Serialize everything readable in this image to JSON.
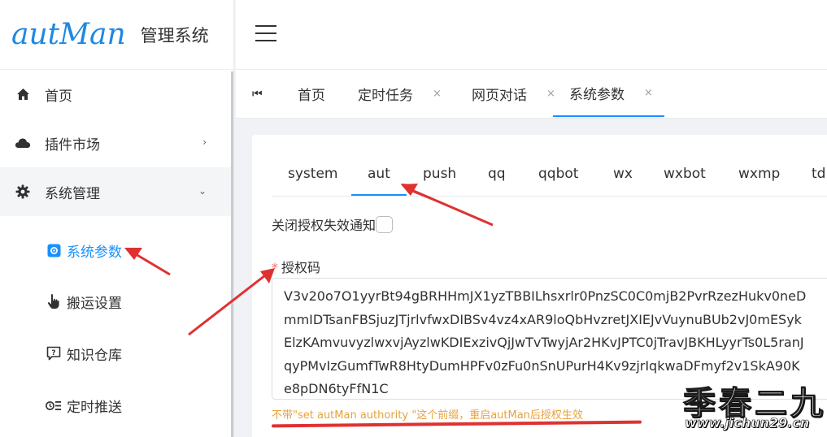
{
  "logo": {
    "brand": "autMan",
    "subtitle": "管理系统"
  },
  "sidebar": {
    "items": [
      {
        "label": "首页",
        "icon": "home-icon"
      },
      {
        "label": "插件市场",
        "icon": "cloud-icon"
      },
      {
        "label": "系统管理",
        "icon": "gear-icon"
      }
    ],
    "sub_items": [
      {
        "label": "系统参数",
        "icon": "settings-square-icon"
      },
      {
        "label": "搬运设置",
        "icon": "hand-pointer-icon"
      },
      {
        "label": "知识仓库",
        "icon": "question-chat-icon"
      },
      {
        "label": "定时推送",
        "icon": "timer-list-icon"
      }
    ]
  },
  "tabs": [
    {
      "label": "首页"
    },
    {
      "label": "定时任务",
      "close": "×"
    },
    {
      "label": "网页对话",
      "close": "×"
    },
    {
      "label": "系统参数",
      "close": "×"
    }
  ],
  "inner_tabs": [
    "system",
    "aut",
    "push",
    "qq",
    "qqbot",
    "wx",
    "wxbot",
    "wxmp",
    "td"
  ],
  "settings": {
    "notify_label": "关闭授权失效通知",
    "required_mark": "*",
    "auth_label": "授权码",
    "auth_lines": [
      "V3v20o7O1yyrBt94gBRHHmJX1yzTBBILhsxrlr0PnzSC0C0mjB2PvrRzezHukv0neD",
      "mmIDTsanFBSjuzJTjrlvfwxDIBSv4vz4xAR9loQbHvzretJXIEJvVuynuBUb2vJ0mESyk",
      "ElzKAmvuvyzlwxvjAyzlwKDIExzivQjJwTvTwyjAr2HKvJPTC0jTravJBKHLyyrTs0L5ranJ",
      "qyPMvIzGumfTwR8HtyDumHPFv0zFu0nSnUPurH4Kv9zjrIqkwaDFmyf2v1SkA90K",
      "e8pDN6tyFfN1C"
    ],
    "hint": "不带\"set autMan authority \"这个前缀，重启autMan后授权生效"
  },
  "watermark": {
    "main": "季春二九",
    "sub": "www.jichun29.cn"
  },
  "colors": {
    "accent": "#1890ff",
    "warning": "#e6a23c",
    "annotation": "#e03131"
  }
}
